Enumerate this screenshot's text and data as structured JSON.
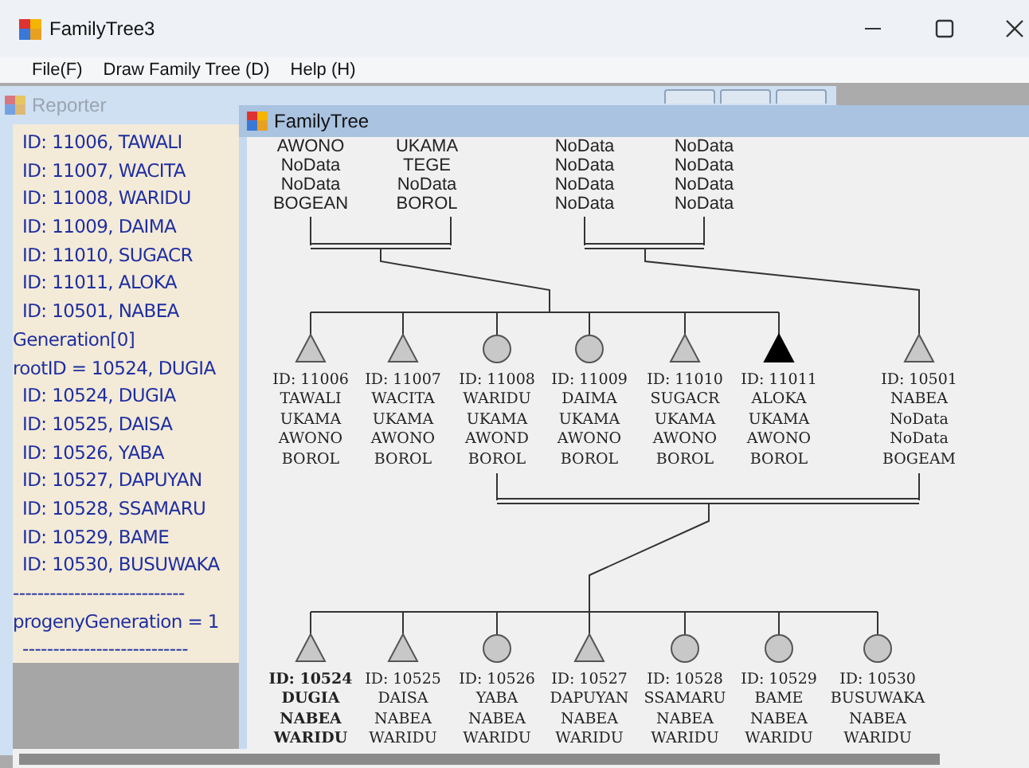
{
  "window": {
    "title": "FamilyTree3"
  },
  "menu": [
    "File(F)",
    "Draw Family Tree (D)",
    "Help (H)"
  ],
  "reporter": {
    "title": "Reporter",
    "lines": [
      {
        "kind": "entry",
        "text": "ID: 11006, TAWALI"
      },
      {
        "kind": "entry",
        "text": "ID: 11007, WACITA"
      },
      {
        "kind": "entry",
        "text": "ID: 11008, WARIDU"
      },
      {
        "kind": "entry",
        "text": "ID: 11009, DAIMA"
      },
      {
        "kind": "entry",
        "text": "ID: 11010, SUGACR"
      },
      {
        "kind": "entry",
        "text": "ID: 11011, ALOKA"
      },
      {
        "kind": "entry",
        "text": "ID: 10501, NABEA"
      },
      {
        "kind": "heading",
        "text": "Generation[0]"
      },
      {
        "kind": "heading",
        "text": "rootID = 10524, DUGIA"
      },
      {
        "kind": "entry",
        "text": "ID: 10524, DUGIA"
      },
      {
        "kind": "entry",
        "text": "ID: 10525, DAISA"
      },
      {
        "kind": "entry",
        "text": "ID: 10526, YABA"
      },
      {
        "kind": "entry",
        "text": "ID: 10527, DAPUYAN"
      },
      {
        "kind": "entry",
        "text": "ID: 10528, SSAMARU"
      },
      {
        "kind": "entry",
        "text": "ID: 10529, BAME"
      },
      {
        "kind": "entry",
        "text": "ID: 10530, BUSUWAKA"
      },
      {
        "kind": "heading",
        "text": "----------------------------"
      },
      {
        "kind": "heading",
        "text": "progenyGeneration = 1"
      },
      {
        "kind": "entry",
        "text": "---------------------------"
      }
    ]
  },
  "family_tree": {
    "title": "FamilyTree",
    "grandparents": [
      {
        "lines": [
          "AWONO",
          "NoData",
          "NoData",
          "BOGEAN"
        ]
      },
      {
        "lines": [
          "UKAMA",
          "TEGE",
          "NoData",
          "BOROL"
        ]
      },
      {
        "lines": [
          "NoData",
          "NoData",
          "NoData",
          "NoData"
        ]
      },
      {
        "lines": [
          "NoData",
          "NoData",
          "NoData",
          "NoData"
        ]
      }
    ],
    "parents_generation": [
      {
        "kind": "triangle",
        "filled": false,
        "lines": [
          "ID: 11006",
          "TAWALI",
          "UKAMA",
          "AWONO",
          "BOROL"
        ]
      },
      {
        "kind": "triangle",
        "filled": false,
        "lines": [
          "ID: 11007",
          "WACITA",
          "UKAMA",
          "AWONO",
          "BOROL"
        ]
      },
      {
        "kind": "circle",
        "filled": false,
        "lines": [
          "ID: 11008",
          "WARIDU",
          "UKAMA",
          "AWOND",
          "BOROL"
        ]
      },
      {
        "kind": "circle",
        "filled": false,
        "lines": [
          "ID: 11009",
          "DAIMA",
          "UKAMA",
          "AWONO",
          "BOROL"
        ]
      },
      {
        "kind": "triangle",
        "filled": false,
        "lines": [
          "ID: 11010",
          "SUGACR",
          "UKAMA",
          "AWONO",
          "BOROL"
        ]
      },
      {
        "kind": "triangle",
        "filled": true,
        "lines": [
          "ID: 11011",
          "ALOKA",
          "UKAMA",
          "AWONO",
          "BOROL"
        ]
      },
      {
        "kind": "triangle",
        "filled": false,
        "lines": [
          "ID: 10501",
          "NABEA",
          "NoData",
          "NoData",
          "BOGEAM"
        ]
      }
    ],
    "children": [
      {
        "kind": "triangle",
        "root": true,
        "lines": [
          "ID: 10524",
          "DUGIA",
          "NABEA",
          "WARIDU"
        ]
      },
      {
        "kind": "triangle",
        "root": false,
        "lines": [
          "ID: 10525",
          "DAISA",
          "NABEA",
          "WARIDU"
        ]
      },
      {
        "kind": "circle",
        "root": false,
        "lines": [
          "ID: 10526",
          "YABA",
          "NABEA",
          "WARIDU"
        ]
      },
      {
        "kind": "triangle",
        "root": false,
        "lines": [
          "ID: 10527",
          "DAPUYAN",
          "NABEA",
          "WARIDU"
        ]
      },
      {
        "kind": "circle",
        "root": false,
        "lines": [
          "ID: 10528",
          "SSAMARU",
          "NABEA",
          "WARIDU"
        ]
      },
      {
        "kind": "circle",
        "root": false,
        "lines": [
          "ID: 10529",
          "BAME",
          "NABEA",
          "WARIDU"
        ]
      },
      {
        "kind": "circle",
        "root": false,
        "lines": [
          "ID: 10530",
          "BUSUWAKA",
          "NABEA",
          "WARIDU"
        ]
      }
    ]
  }
}
